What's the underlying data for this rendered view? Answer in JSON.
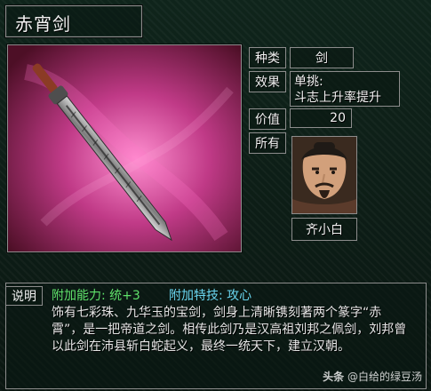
{
  "item": {
    "title": "赤宵剑",
    "labels": {
      "type": "种类",
      "effect": "效果",
      "value": "价值",
      "owner": "所有",
      "desc": "说明"
    },
    "type_value": "剑",
    "effect_line1": "单挑:",
    "effect_line2": "斗志上升率提升",
    "value": "20",
    "owner_name": "齐小白"
  },
  "description": {
    "ability_label": "附加能力:",
    "ability_value": "统+3",
    "special_label": "附加特技:",
    "special_value": "攻心",
    "text": "饰有七彩珠、九华玉的宝剑，剑身上清晰镌刻著两个篆字“赤霄”，是一把帝道之剑。相传此剑乃是汉高祖刘邦之佩剑，刘邦曾以此剑在沛县斩白蛇起义，最终一统天下，建立汉朝。"
  },
  "watermark": {
    "brand": "头条",
    "handle": "@白给的绿豆汤"
  },
  "colors": {
    "bg": "#0b1712",
    "green": "#5fe06a",
    "cyan": "#6ad6f0"
  }
}
